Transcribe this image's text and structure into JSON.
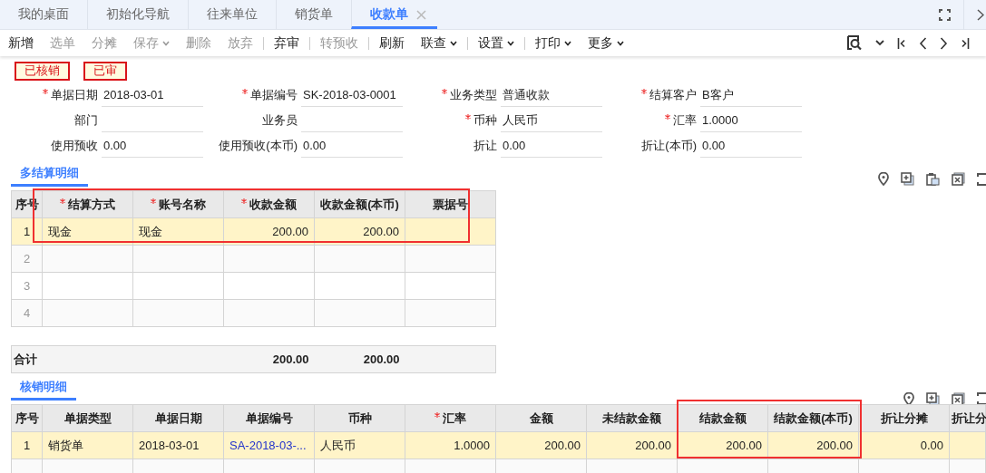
{
  "tabs": [
    {
      "label": "我的桌面",
      "selected": false
    },
    {
      "label": "初始化导航",
      "selected": false
    },
    {
      "label": "往来单位",
      "selected": false
    },
    {
      "label": "销货单",
      "selected": false
    },
    {
      "label": "收款单",
      "selected": true
    }
  ],
  "toolbar": {
    "groups": [
      [
        {
          "label": "新增",
          "disabled": false,
          "dropdown": false
        },
        {
          "label": "选单",
          "disabled": true,
          "dropdown": false
        },
        {
          "label": "分摊",
          "disabled": true,
          "dropdown": false
        },
        {
          "label": "保存",
          "disabled": true,
          "dropdown": true
        },
        {
          "label": "删除",
          "disabled": true,
          "dropdown": false
        },
        {
          "label": "放弃",
          "disabled": true,
          "dropdown": false
        }
      ],
      [
        {
          "label": "弃审",
          "disabled": false,
          "dropdown": false
        }
      ],
      [
        {
          "label": "转预收",
          "disabled": true,
          "dropdown": false
        }
      ],
      [
        {
          "label": "刷新",
          "disabled": false,
          "dropdown": false
        },
        {
          "label": "联查",
          "disabled": false,
          "dropdown": true
        }
      ],
      [
        {
          "label": "设置",
          "disabled": false,
          "dropdown": true
        }
      ],
      [
        {
          "label": "打印",
          "disabled": false,
          "dropdown": true
        },
        {
          "label": "更多",
          "disabled": false,
          "dropdown": true
        }
      ]
    ]
  },
  "stamps": [
    "已核销",
    "已审"
  ],
  "form": {
    "fields": [
      {
        "label": "单据日期",
        "required": true,
        "value": "2018-03-01"
      },
      {
        "label": "单据编号",
        "required": true,
        "value": "SK-2018-03-0001"
      },
      {
        "label": "业务类型",
        "required": true,
        "value": "普通收款"
      },
      {
        "label": "结算客户",
        "required": true,
        "value": "B客户"
      },
      {
        "label": "部门",
        "required": false
      },
      {
        "label": "业务员",
        "required": false
      },
      {
        "label": "币种",
        "required": true,
        "value": "人民币"
      },
      {
        "label": "汇率",
        "required": true,
        "value": "1.0000"
      },
      {
        "label": "使用预收",
        "required": false,
        "value": "0.00"
      },
      {
        "label": "使用预收(本币)",
        "required": false,
        "value": "0.00"
      },
      {
        "label": "折让",
        "required": false,
        "value": "0.00"
      },
      {
        "label": "折让(本币)",
        "required": false,
        "value": "0.00"
      }
    ]
  },
  "sections": [
    {
      "title": "多结算明细",
      "index_header": "序号",
      "columns": [
        {
          "label": "结算方式",
          "required": true,
          "kind": "text"
        },
        {
          "label": "账号名称",
          "required": true,
          "kind": "text"
        },
        {
          "label": "收款金额",
          "required": true,
          "kind": "number"
        },
        {
          "label": "收款金额(本币)",
          "required": false,
          "kind": "number"
        },
        {
          "label": "票据号",
          "required": false,
          "kind": "text"
        }
      ],
      "rows": [
        {
          "index": "1",
          "selected": true,
          "cells": [
            "现金",
            "现金",
            "200.00",
            "200.00"
          ]
        },
        {
          "index": "2",
          "selected": false,
          "cells": []
        },
        {
          "index": "3",
          "selected": false,
          "cells": []
        },
        {
          "index": "4",
          "selected": false,
          "cells": []
        }
      ],
      "total": {
        "label": "合计",
        "amounts": [
          "200.00",
          "200.00"
        ]
      }
    },
    {
      "title": "核销明细",
      "index_header": "序号",
      "columns": [
        {
          "label": "单据类型",
          "required": false,
          "kind": "text"
        },
        {
          "label": "单据日期",
          "required": false,
          "kind": "text"
        },
        {
          "label": "单据编号",
          "required": false,
          "kind": "link"
        },
        {
          "label": "币种",
          "required": false,
          "kind": "text"
        },
        {
          "label": "汇率",
          "required": true,
          "kind": "number"
        },
        {
          "label": "金额",
          "required": false,
          "kind": "number"
        },
        {
          "label": "未结款金额",
          "required": false,
          "kind": "number"
        },
        {
          "label": "结款金额",
          "required": false,
          "kind": "number"
        },
        {
          "label": "结款金额(本币)",
          "required": false,
          "kind": "number"
        },
        {
          "label": "折让分摊",
          "required": false,
          "kind": "number"
        },
        {
          "label": "折让分",
          "required": false,
          "kind": "number"
        }
      ],
      "rows": [
        {
          "index": "1",
          "selected": true,
          "cells": [
            "销货单",
            "2018-03-01",
            "SA-2018-03-...",
            "人民币",
            "1.0000",
            "200.00",
            "200.00",
            "200.00",
            "200.00",
            "0.00"
          ]
        },
        {
          "selected": false,
          "cells": []
        }
      ]
    }
  ]
}
